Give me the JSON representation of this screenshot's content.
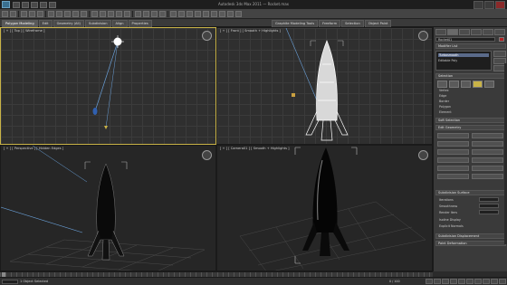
{
  "window": {
    "title": "Autodesk 3ds Max 2011 — Rocket.max"
  },
  "ribbon": {
    "tabs": [
      {
        "label": "Graphite Modeling Tools"
      },
      {
        "label": "Freeform"
      },
      {
        "label": "Selection"
      },
      {
        "label": "Object Paint"
      }
    ],
    "subtabs": [
      {
        "label": "Polygon Modeling"
      },
      {
        "label": "Edit"
      },
      {
        "label": "Geometry (All)"
      },
      {
        "label": "Subdivision"
      },
      {
        "label": "Align"
      },
      {
        "label": "Properties"
      }
    ]
  },
  "viewports": {
    "top": {
      "label": "[ + ] [ Top ] [ Wireframe ]"
    },
    "front": {
      "label": "[ + ] [ Front ] [ Smooth + Highlights ]"
    },
    "perspective1": {
      "label": "[ + ] [ Perspective ] [ Hidden Edges ]"
    },
    "perspective2": {
      "label": "[ + ] [ Camera01 ] [ Smooth + Highlights ]"
    }
  },
  "command_panel": {
    "object_name": "Rocket01",
    "rollouts": [
      {
        "label": "Modifier List"
      },
      {
        "label": "Turbosmooth"
      },
      {
        "label": "Editable Poly"
      },
      {
        "label": "Selection"
      },
      {
        "label": "Soft Selection"
      },
      {
        "label": "Edit Geometry"
      },
      {
        "label": "Subdivision Surface"
      },
      {
        "label": "Subdivision Displacement"
      },
      {
        "label": "Paint Deformation"
      }
    ],
    "options": [
      {
        "label": "Vertex"
      },
      {
        "label": "Edge"
      },
      {
        "label": "Border"
      },
      {
        "label": "Polygon"
      },
      {
        "label": "Element"
      }
    ],
    "params": [
      {
        "label": "Iterations"
      },
      {
        "label": "Smoothness"
      },
      {
        "label": "Render Iters"
      },
      {
        "label": "Isoline Display"
      },
      {
        "label": "Explicit Normals"
      }
    ],
    "colors": {
      "swatch": "#b02020"
    }
  },
  "status": {
    "message": "1 Object Selected",
    "frame": "0 / 100"
  }
}
